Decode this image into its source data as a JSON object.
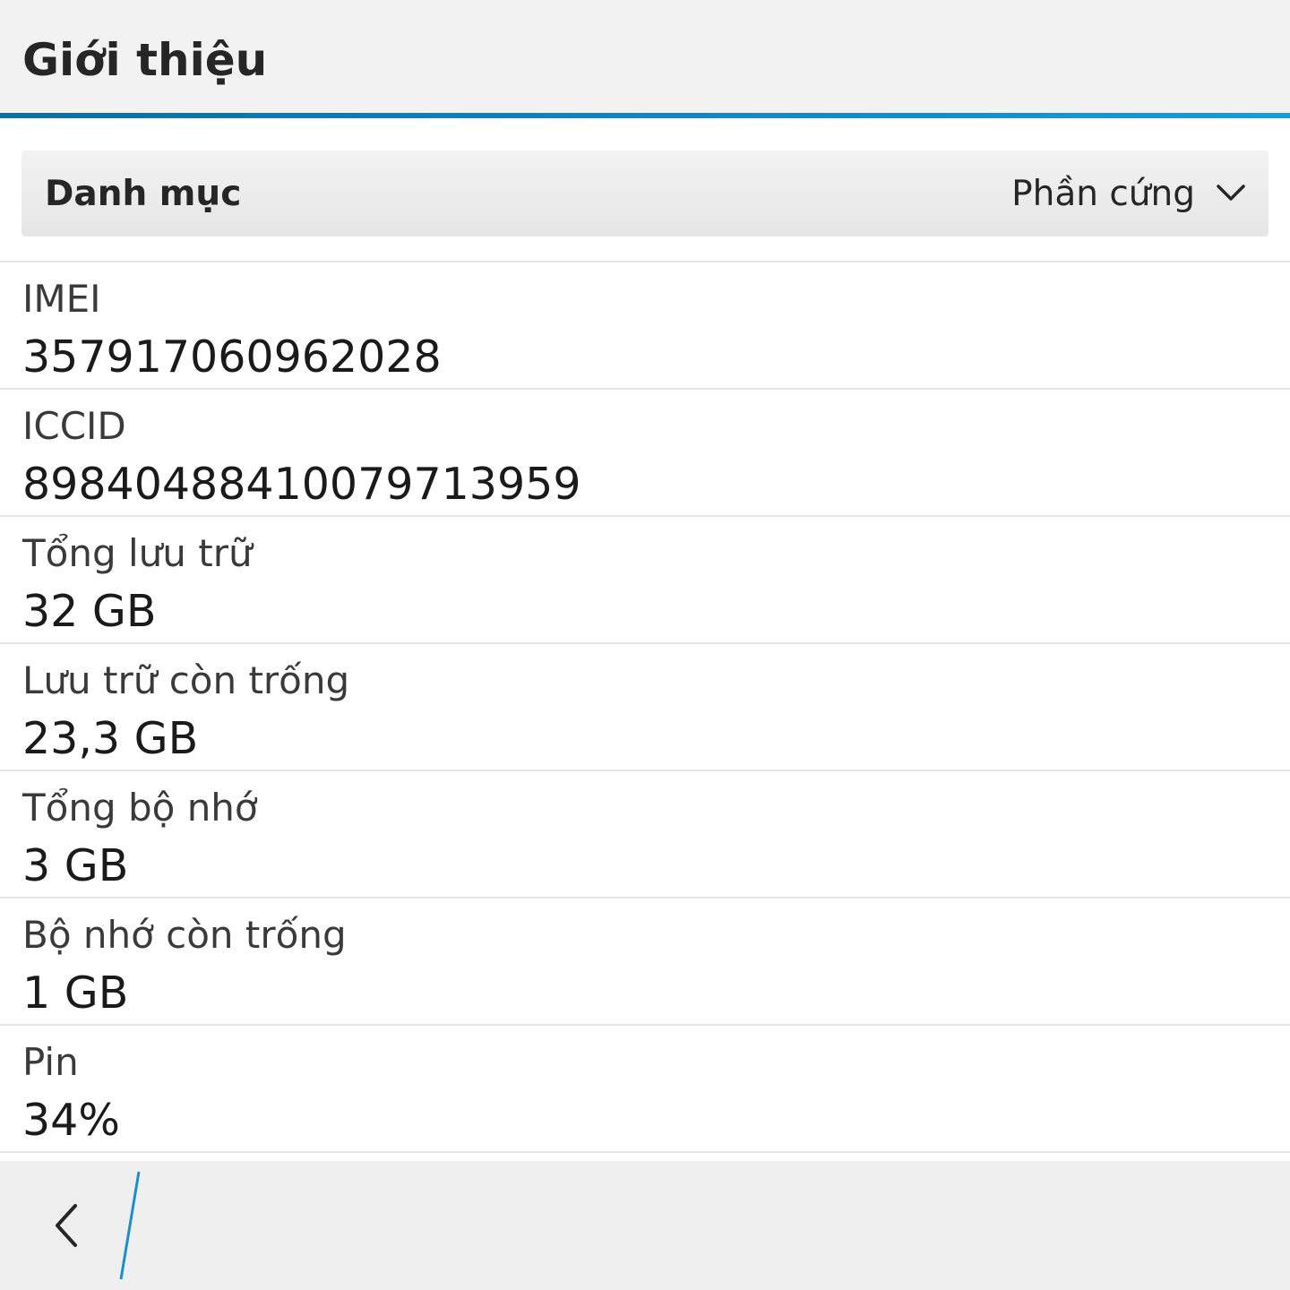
{
  "header": {
    "title": "Giới thiệu"
  },
  "category": {
    "label": "Danh mục",
    "selected": "Phần cứng",
    "icon": "chevron-down-icon"
  },
  "items": [
    {
      "label": "IMEI",
      "value": "357917060962028"
    },
    {
      "label": "ICCID",
      "value": "89840488410079713959"
    },
    {
      "label": "Tổng lưu trữ",
      "value": "32 GB"
    },
    {
      "label": "Lưu trữ còn trống",
      "value": "23,3 GB"
    },
    {
      "label": "Tổng bộ nhớ",
      "value": "3 GB"
    },
    {
      "label": "Bộ nhớ còn trống",
      "value": "1 GB"
    },
    {
      "label": "Pin",
      "value": "34%"
    }
  ],
  "actionbar": {
    "back_icon": "chevron-left-icon"
  },
  "colors": {
    "accent": "#1a8fcc",
    "accent_dark": "#0d6fa3",
    "header_bg": "#f2f2f2",
    "text": "#262626"
  }
}
